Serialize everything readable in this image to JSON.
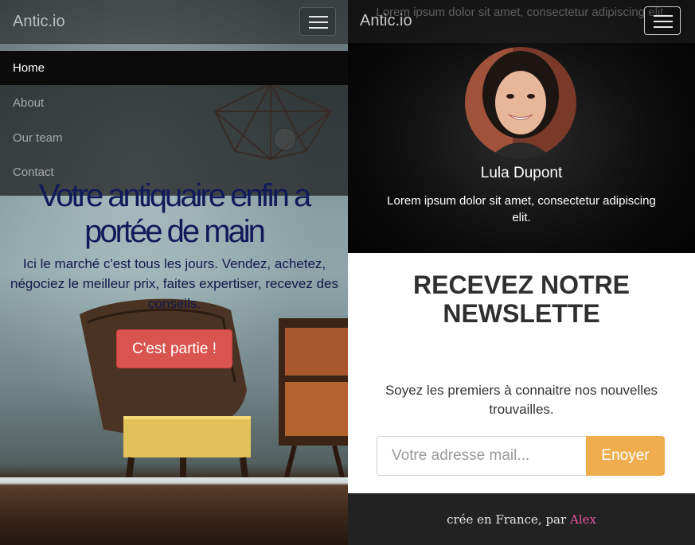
{
  "brand": "Antic.io",
  "nav": {
    "items": [
      {
        "label": "Home",
        "active": true
      },
      {
        "label": "About",
        "active": false
      },
      {
        "label": "Our team",
        "active": false
      },
      {
        "label": "Contact",
        "active": false
      }
    ]
  },
  "hero": {
    "title": "Votre antiquaire enfin a portée de main",
    "text": "Ici le marché c'est tous les jours. Vendez, achetez, négociez le meilleur prix, faites expertiser, recevez des conseils.",
    "cta_label": "C'est partie !",
    "cta_color": "#d9534f"
  },
  "team": {
    "ghost_text": "Lorem ipsum dolor sit amet, consectetur adipiscing elit.",
    "member_name": "Lula Dupont",
    "member_bio": "Lorem ipsum dolor sit amet, consectetur adipiscing elit."
  },
  "newsletter": {
    "title": "RECEVEZ NOTRE NEWSLETTE",
    "text": "Soyez les premiers à connaitre nos nouvelles trouvailles.",
    "input_placeholder": "Votre adresse mail...",
    "button_label": "Enoyer",
    "button_color": "#f0ad4e"
  },
  "footer": {
    "text_prefix": "crée en France, par ",
    "author_link": "Alex",
    "link_color": "#e7559b"
  },
  "icons": {
    "menu": "hamburger-icon"
  }
}
